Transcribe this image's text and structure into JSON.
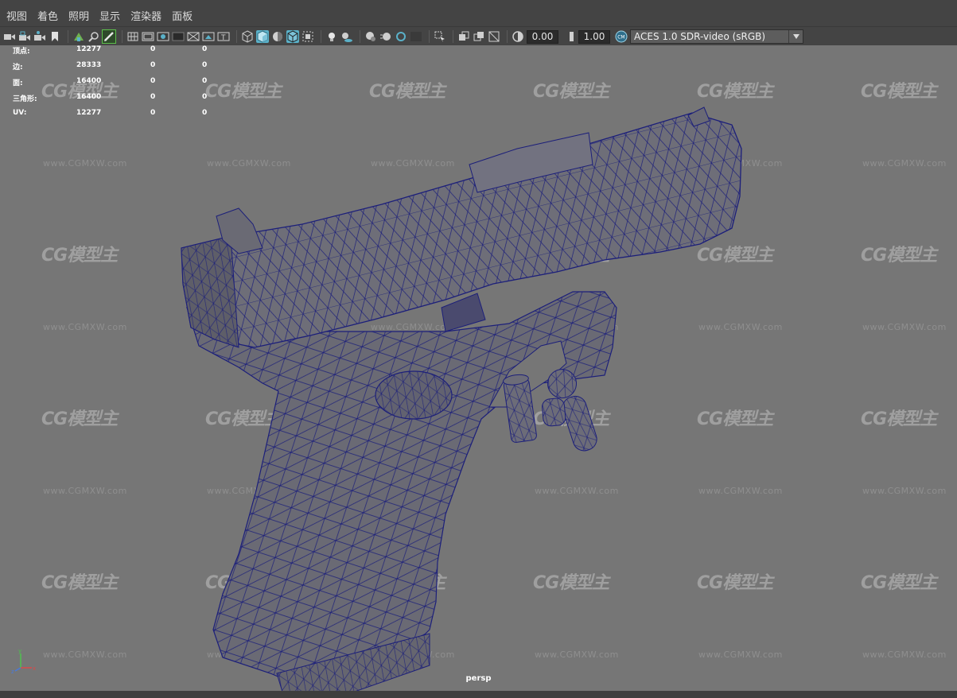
{
  "menubar": {
    "items": [
      "视图",
      "着色",
      "照明",
      "显示",
      "渲染器",
      "面板"
    ]
  },
  "toolbar": {
    "icons": [
      "camera-select-icon",
      "camera-lock-icon",
      "camera-attributes-icon",
      "bookmark-icon",
      "image-plane-icon",
      "grease-pencil-icon",
      "2d-pan-zoom-icon",
      "grid-icon",
      "film-gate-icon",
      "resolution-gate-icon",
      "gate-mask-icon",
      "field-chart-icon",
      "safe-action-icon",
      "safe-title-icon",
      "wireframe-icon",
      "smooth-shade-icon",
      "default-material-icon",
      "wireframe-on-shaded-icon",
      "xray-icon",
      "use-all-lights-icon",
      "shadows-icon",
      "ambient-occlusion-icon",
      "motion-blur-icon",
      "multisample-aa-icon",
      "depth-of-field-icon",
      "stereo-icon",
      "isolate-select-icon",
      "xray-joints-icon",
      "xray-active-icon",
      "textured-icon",
      "exposure-icon",
      "gamma-icon",
      "color-management-icon"
    ],
    "exposure_value": "0.00",
    "gamma_value": "1.00",
    "view_transform": "ACES 1.0 SDR-video (sRGB)"
  },
  "hud": {
    "rows": [
      {
        "label": "顶点:",
        "v1": "12277",
        "v2": "0",
        "v3": "0"
      },
      {
        "label": "边:",
        "v1": "28333",
        "v2": "0",
        "v3": "0"
      },
      {
        "label": "面:",
        "v1": "16400",
        "v2": "0",
        "v3": "0"
      },
      {
        "label": "三角形:",
        "v1": "16400",
        "v2": "0",
        "v3": "0"
      },
      {
        "label": "UV:",
        "v1": "12277",
        "v2": "0",
        "v3": "0"
      }
    ]
  },
  "viewport": {
    "camera": "persp",
    "axis_labels": {
      "x": "x",
      "y": "y",
      "z": "z"
    },
    "watermark_logo": "CG模型主",
    "watermark_url": "www.CGMXW.com"
  },
  "colors": {
    "ui_background": "#444444",
    "viewport_background": "#767676",
    "wireframe": "#1c1f7a",
    "model_shade": "#6a6a74",
    "active_tool_outline": "#5cbf4a",
    "toggle_on": "#5ab1c9"
  }
}
